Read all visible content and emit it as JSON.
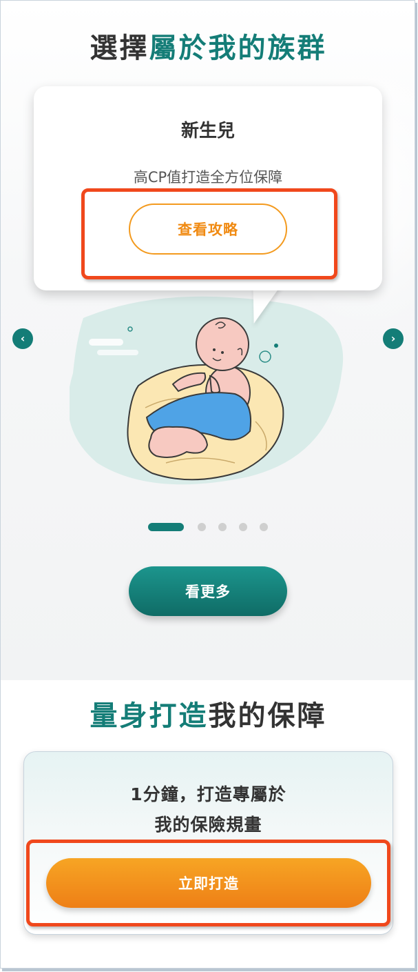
{
  "section1": {
    "title_part1": "選擇",
    "title_part2": "屬於我的族群"
  },
  "group_card": {
    "name": "新生兒",
    "subtitle": "高CP值打造全方位保障",
    "button_label": "查看攻略"
  },
  "carousel": {
    "prev_icon": "‹",
    "next_icon": "›",
    "total_slides": 5,
    "active_index": 0
  },
  "more_button_label": "看更多",
  "section2": {
    "title_part1": "量身打造",
    "title_part2": "我的保障"
  },
  "plan_card": {
    "line1": "1分鐘，打造專屬於",
    "line2": "我的保險規畫",
    "button_label": "立即打造"
  },
  "colors": {
    "teal": "#147d77",
    "orange": "#f08a12",
    "highlight": "#f0481c"
  }
}
